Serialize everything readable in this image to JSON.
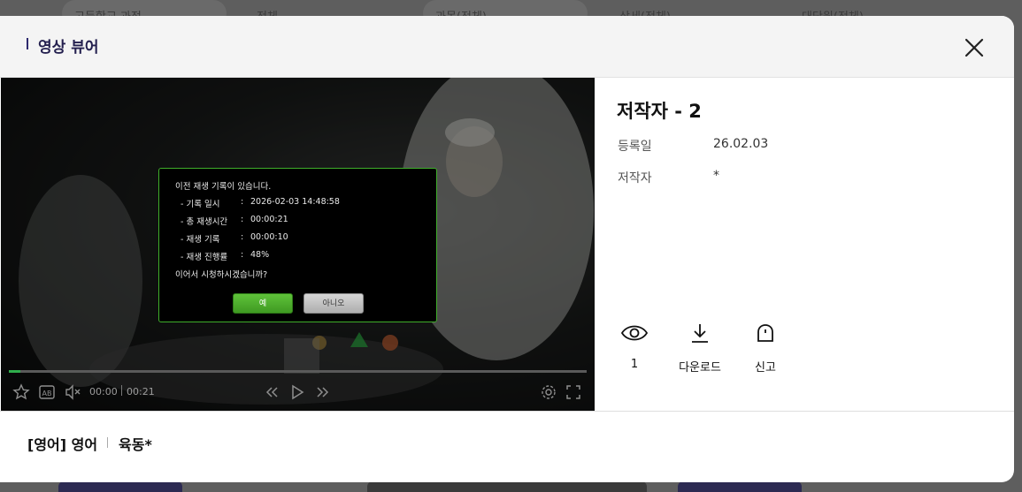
{
  "background": {
    "filters": [
      "고등학교 과정",
      "전체",
      "과목(전체)",
      "상세(전체)",
      "대단원(전체)"
    ]
  },
  "modal": {
    "title": "영상 뷰어",
    "close_icon": "close-icon"
  },
  "player": {
    "current_time": "00:00",
    "duration": "00:21",
    "progress_fraction": 0.02,
    "icons": [
      "star-icon",
      "ab-repeat-icon",
      "mute-icon",
      "rewind-icon",
      "play-icon",
      "fast-forward-icon",
      "settings-icon",
      "fullscreen-icon"
    ],
    "resume_dialog": {
      "heading": "이전 재생 기록이 있습니다.",
      "rows": [
        {
          "label": "- 기록 일시",
          "value": "2026-02-03 14:48:58"
        },
        {
          "label": "- 총 재생시간",
          "value": "00:00:21"
        },
        {
          "label": "- 재생 기록",
          "value": "00:00:10"
        },
        {
          "label": "- 재생 진행률",
          "value": "48%"
        }
      ],
      "question": "이어서 시청하시겠습니까?",
      "yes_label": "예",
      "no_label": "아니오"
    }
  },
  "info": {
    "title": "저작자 - 2",
    "meta": [
      {
        "label": "등록일",
        "value": "26.02.03"
      },
      {
        "label": "저작자",
        "value": "*"
      }
    ],
    "actions": [
      {
        "icon": "eye-icon",
        "label": "1"
      },
      {
        "icon": "download-icon",
        "label": "다운로드"
      },
      {
        "icon": "report-bell-icon",
        "label": "신고"
      }
    ]
  },
  "footer": {
    "language": "[영어] 영어",
    "category": "육동*"
  },
  "colors": {
    "accent_green": "#3fae2a",
    "title_navy": "#24204f"
  }
}
